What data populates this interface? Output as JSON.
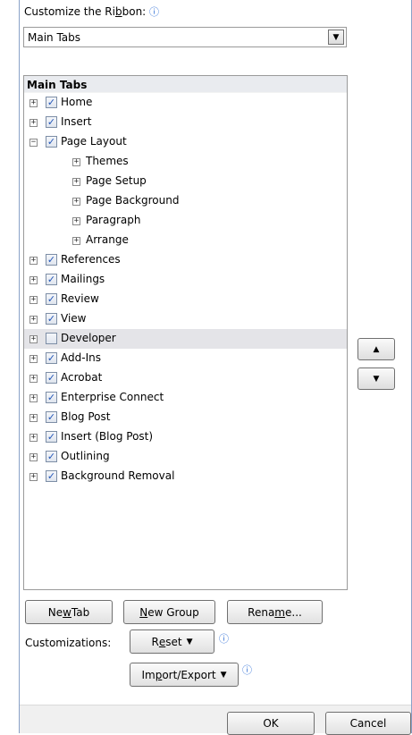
{
  "customize_label_pre": "Customize the Ri",
  "customize_label_key": "b",
  "customize_label_post": "bon:",
  "dropdown_value": "Main Tabs",
  "tree": {
    "header": "Main Tabs",
    "rows": [
      {
        "label": "Home",
        "level": 0,
        "expander": "+",
        "checked": true
      },
      {
        "label": "Insert",
        "level": 0,
        "expander": "+",
        "checked": true
      },
      {
        "label": "Page Layout",
        "level": 0,
        "expander": "−",
        "checked": true
      },
      {
        "label": "Themes",
        "level": 1,
        "expander": "+"
      },
      {
        "label": "Page Setup",
        "level": 1,
        "expander": "+"
      },
      {
        "label": "Page Background",
        "level": 1,
        "expander": "+"
      },
      {
        "label": "Paragraph",
        "level": 1,
        "expander": "+"
      },
      {
        "label": "Arrange",
        "level": 1,
        "expander": "+"
      },
      {
        "label": "References",
        "level": 0,
        "expander": "+",
        "checked": true
      },
      {
        "label": "Mailings",
        "level": 0,
        "expander": "+",
        "checked": true
      },
      {
        "label": "Review",
        "level": 0,
        "expander": "+",
        "checked": true
      },
      {
        "label": "View",
        "level": 0,
        "expander": "+",
        "checked": true
      },
      {
        "label": "Developer",
        "level": 0,
        "expander": "+",
        "checked": false,
        "highlight": true
      },
      {
        "label": "Add-Ins",
        "level": 0,
        "expander": "+",
        "checked": true
      },
      {
        "label": "Acrobat",
        "level": 0,
        "expander": "+",
        "checked": true
      },
      {
        "label": "Enterprise Connect",
        "level": 0,
        "expander": "+",
        "checked": true
      },
      {
        "label": "Blog Post",
        "level": 0,
        "expander": "+",
        "checked": true
      },
      {
        "label": "Insert (Blog Post)",
        "level": 0,
        "expander": "+",
        "checked": true
      },
      {
        "label": "Outlining",
        "level": 0,
        "expander": "+",
        "checked": true
      },
      {
        "label": "Background Removal",
        "level": 0,
        "expander": "+",
        "checked": true
      }
    ]
  },
  "buttons": {
    "new_tab": {
      "pre": "Ne",
      "key": "w",
      "post": " Tab"
    },
    "new_group": {
      "pre": "",
      "key": "N",
      "post": "ew Group"
    },
    "rename": {
      "pre": "Rena",
      "key": "m",
      "post": "e..."
    },
    "reset": {
      "pre": "R",
      "key": "e",
      "post": "set"
    },
    "import_export": {
      "pre": "Im",
      "key": "p",
      "post": "ort/Export"
    },
    "ok": "OK",
    "cancel": "Cancel"
  },
  "customizations_label": "Customizations:",
  "icons": {
    "info": "ⓘ",
    "checkmark": "✓",
    "arrow_up": "▲",
    "arrow_down": "▼",
    "dropdown_caret": "▼"
  },
  "colors": {
    "accent": "#2f6fd6",
    "check": "#2256b8",
    "highlight": "#e4e4e8"
  }
}
